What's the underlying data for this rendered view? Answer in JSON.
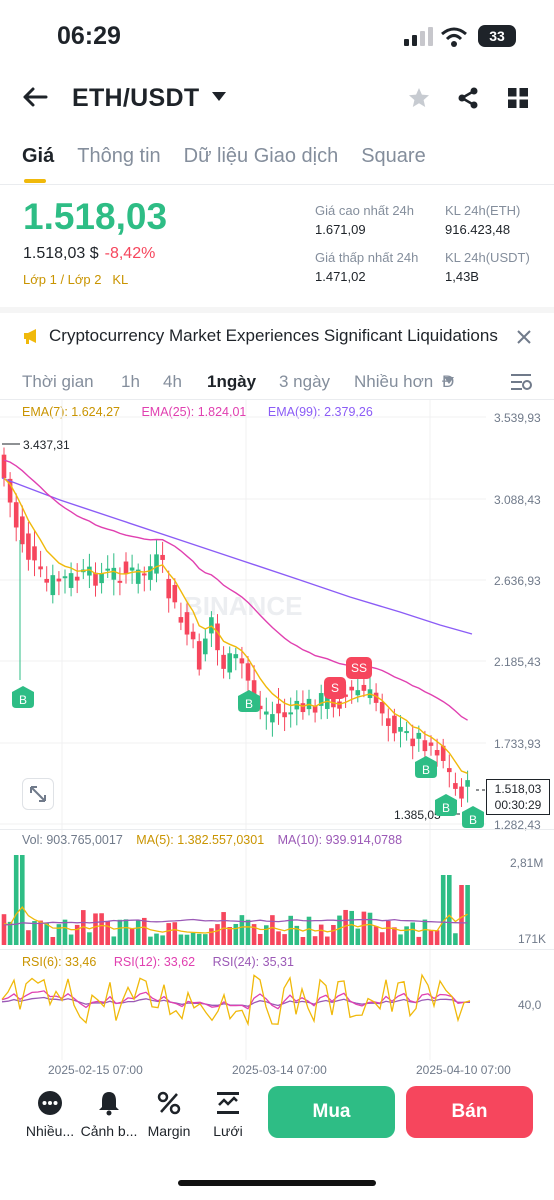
{
  "status": {
    "time": "06:29",
    "battery": "33"
  },
  "header": {
    "pair": "ETH/USDT"
  },
  "tabs": [
    "Giá",
    "Thông tin",
    "Dữ liệu Giao dịch",
    "Square"
  ],
  "price": {
    "last": "1.518,03",
    "usd": "1.518,03 $",
    "change": "-8,42%",
    "layers": "Lớp 1 / Lớp 2",
    "kl": "KL",
    "high_label": "Giá cao nhất 24h",
    "high": "1.671,09",
    "low_label": "Giá thấp nhất 24h",
    "low": "1.471,02",
    "vol_eth_label": "KL 24h(ETH)",
    "vol_eth": "916.423,48",
    "vol_usdt_label": "KL 24h(USDT)",
    "vol_usdt": "1,43B"
  },
  "news": {
    "text": "Cryptocurrency Market Experiences Significant Liquidations"
  },
  "intervals": [
    "Thời gian",
    "1h",
    "4h",
    "1ngày",
    "3 ngày",
    "Nhiều hơn",
    "Đ"
  ],
  "ema": {
    "ema7": "EMA(7): 1.624,27",
    "ema25": "EMA(25): 1.824,01",
    "ema99": "EMA(99): 2.379,26"
  },
  "price_axis": [
    "3.539,93",
    "3.088,43",
    "2.636,93",
    "2.185,43",
    "1.733,93",
    "1.282,43"
  ],
  "chart_labels": {
    "high_mark": "3.437,31",
    "low_mark": "1.385,05",
    "current": "1.518,03",
    "countdown": "00:30:29",
    "watermark": "BINANCE",
    "s": "S",
    "ss": "SS",
    "b": "B"
  },
  "volume": {
    "vol": "Vol: 903.765,0017",
    "ma5": "MA(5): 1.382.557,0301",
    "ma10": "MA(10): 939.914,0788",
    "axis_top": "2,81M",
    "axis_bottom": "171K"
  },
  "rsi": {
    "rsi6": "RSI(6): 33,46",
    "rsi12": "RSI(12): 33,62",
    "rsi24": "RSI(24): 35,31",
    "level": "40,0"
  },
  "dates": [
    "2025-02-15 07:00",
    "2025-03-14 07:00",
    "2025-04-10 07:00"
  ],
  "bottom": {
    "more": "Nhiều...",
    "alert": "Cảnh b...",
    "margin": "Margin",
    "grid": "Lưới",
    "buy": "Mua",
    "sell": "Bán"
  },
  "colors": {
    "up": "#2ebd85",
    "down": "#f6465d",
    "accent": "#f0b90b",
    "ema7": "#f0b90b",
    "ema25": "#e040b0",
    "ema99": "#8b5cf6"
  }
}
